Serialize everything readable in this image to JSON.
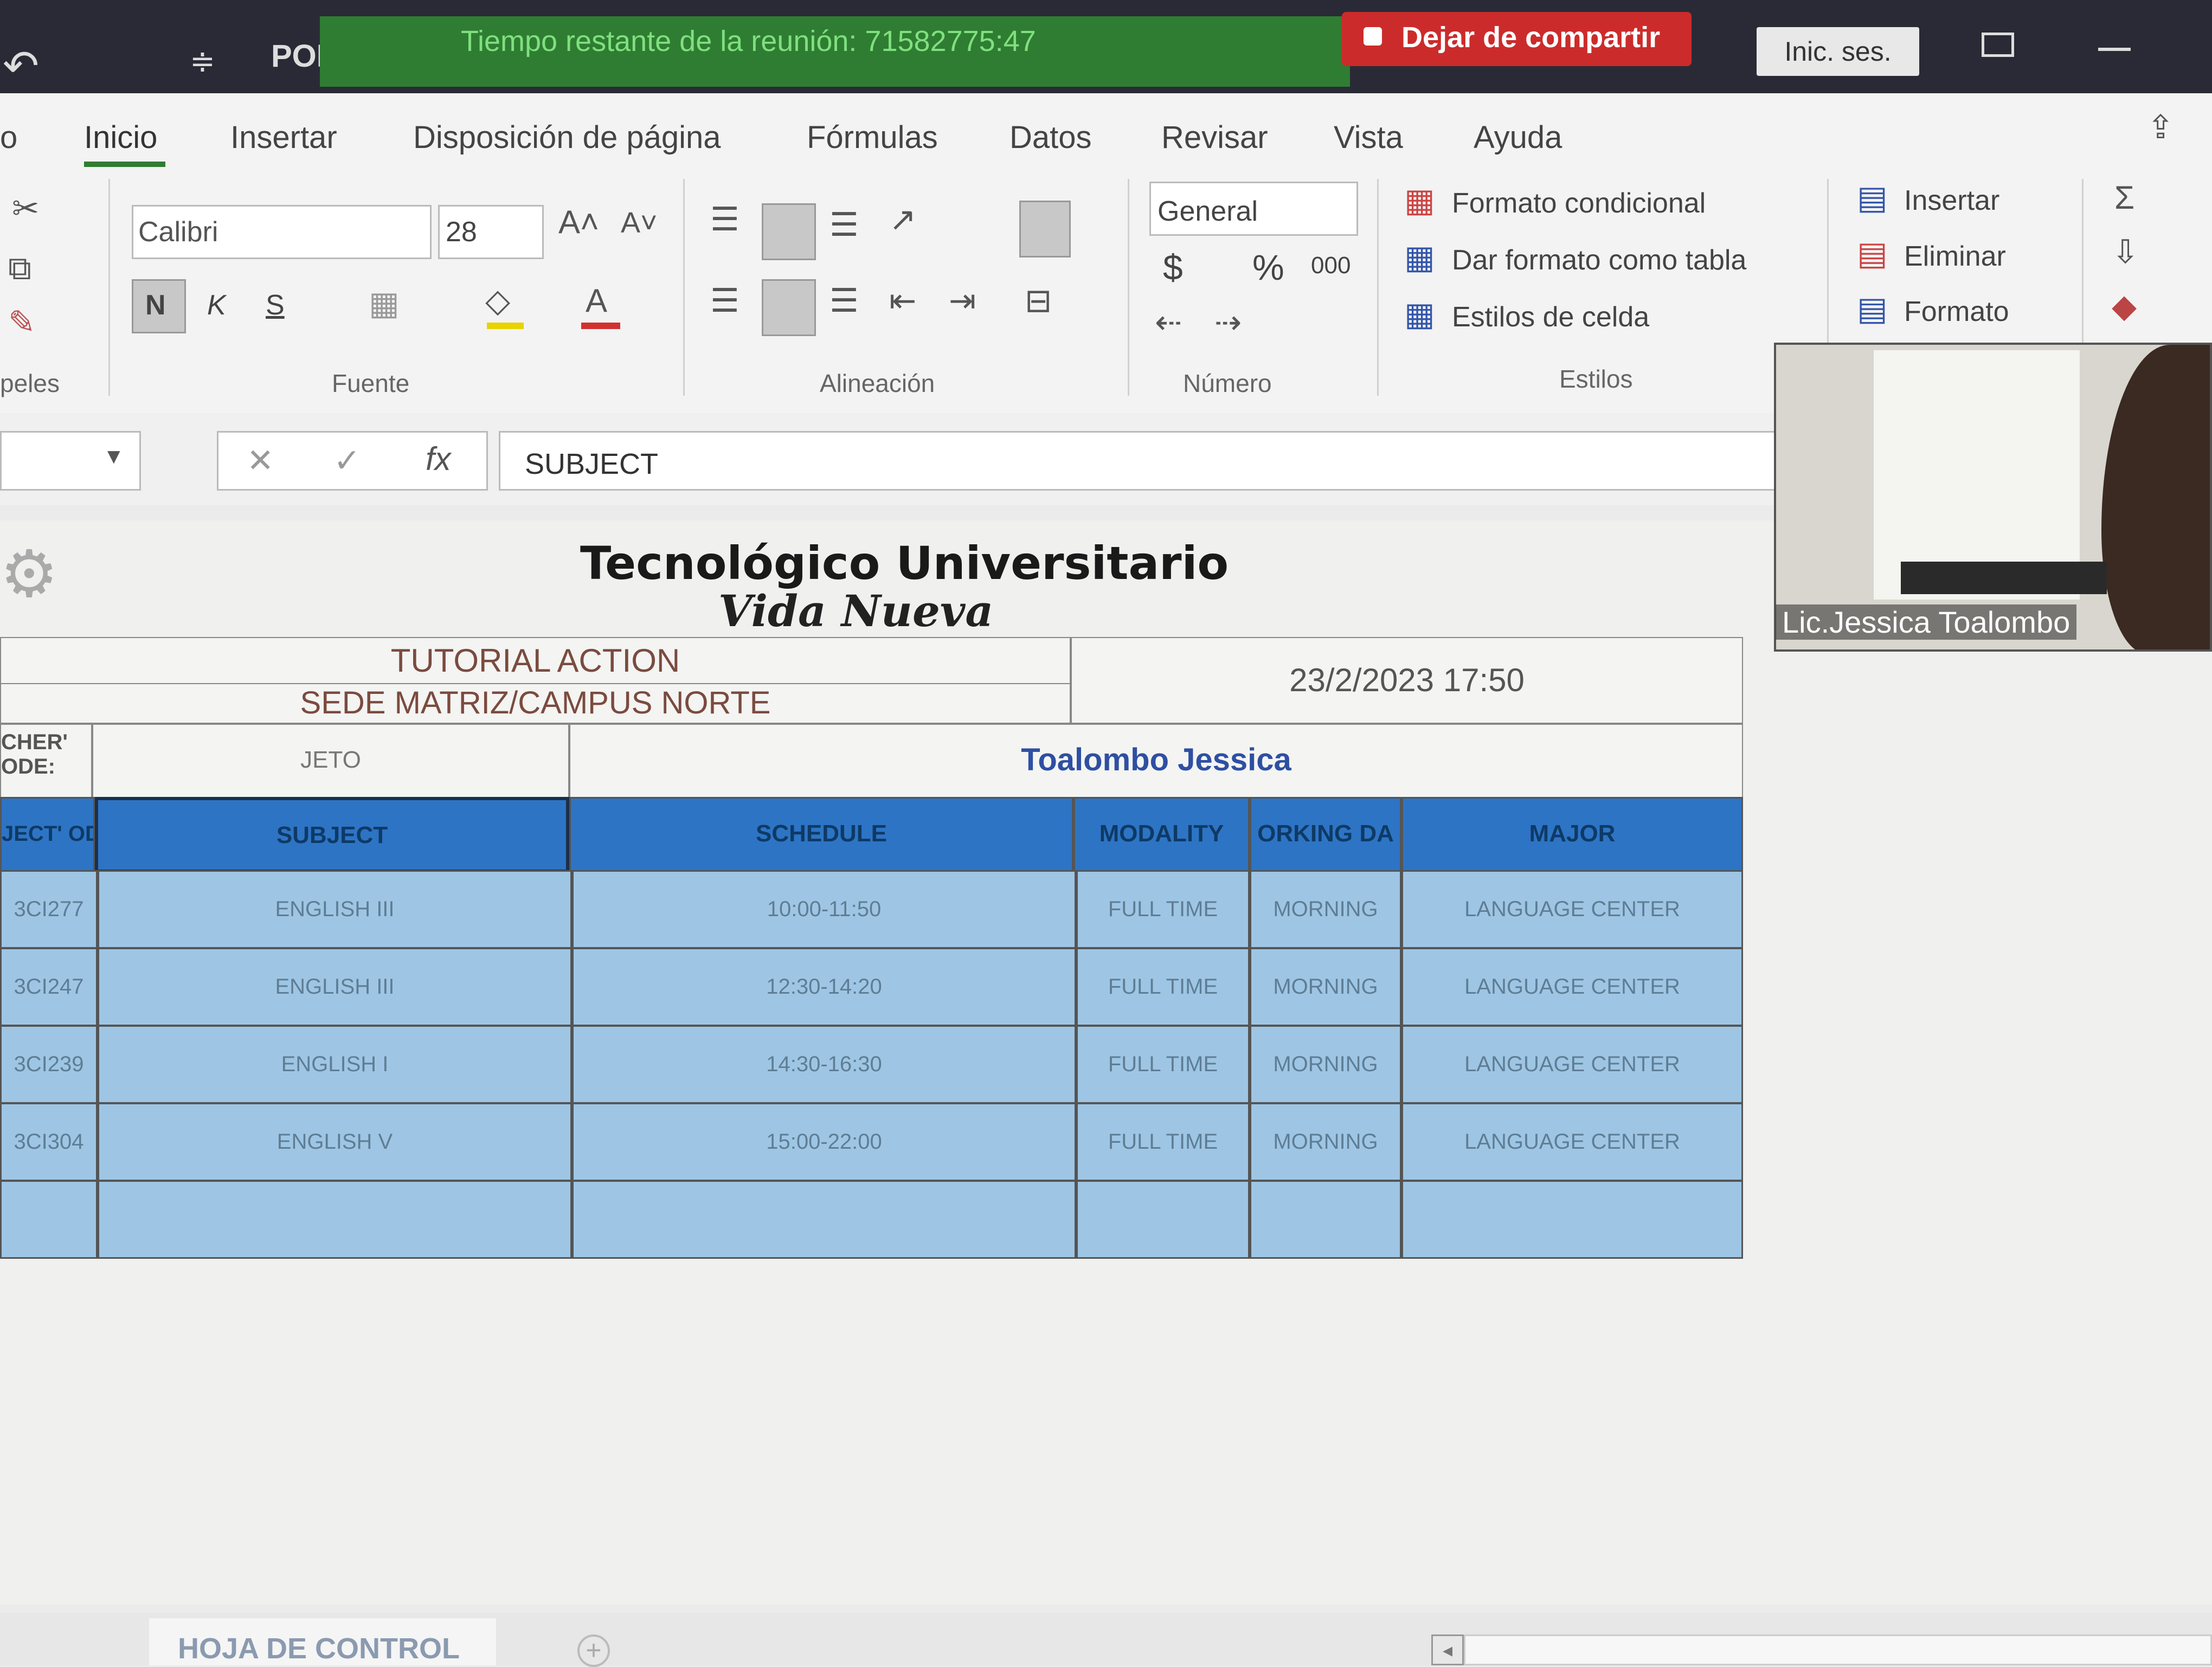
{
  "titlebar": {
    "file_title": "POR",
    "meeting_timer": "Tiempo restante de la reunión: 71582775:47",
    "stop_sharing": "Dejar de compartir",
    "sign_in": "Inic. ses."
  },
  "ribbon": {
    "tabs": [
      "o",
      "Inicio",
      "Insertar",
      "Disposición de página",
      "Fórmulas",
      "Datos",
      "Revisar",
      "Vista",
      "Ayuda"
    ],
    "font_name": "Calibri",
    "font_size": "28",
    "bold": "N",
    "italic": "K",
    "underline": "S",
    "number_format": "General",
    "currency": "$",
    "percent": "%",
    "thousands": "000",
    "conditional_format": "Formato condicional",
    "format_as_table": "Dar formato como tabla",
    "cell_styles": "Estilos de celda",
    "insert": "Insertar",
    "delete": "Eliminar",
    "format": "Formato",
    "groups": {
      "clipboard": "peles",
      "font": "Fuente",
      "alignment": "Alineación",
      "number": "Número",
      "styles": "Estilos"
    }
  },
  "formula_bar": {
    "content": "SUBJECT"
  },
  "sheet": {
    "title_line1": "Tecnológico Universitario",
    "title_line2": "Vida Nueva",
    "subtitle1": "TUTORIAL ACTION",
    "subtitle2": "SEDE MATRIZ/CAMPUS NORTE",
    "datetime": "23/2/2023 17:50",
    "teacher_code_label": "CHER' ODE:",
    "subject_label": "JETO",
    "teacher_name": "Toalombo Jessica",
    "headers": [
      "JECT' ODE:",
      "SUBJECT",
      "SCHEDULE",
      "MODALITY",
      "ORKING DA",
      "MAJOR"
    ],
    "rows": [
      [
        "3CI277",
        "ENGLISH III",
        "10:00-11:50",
        "FULL TIME",
        "MORNING",
        "LANGUAGE CENTER"
      ],
      [
        "3CI247",
        "ENGLISH III",
        "12:30-14:20",
        "FULL TIME",
        "MORNING",
        "LANGUAGE CENTER"
      ],
      [
        "3CI239",
        "ENGLISH I",
        "14:30-16:30",
        "FULL TIME",
        "MORNING",
        "LANGUAGE CENTER"
      ],
      [
        "3CI304",
        "ENGLISH V",
        "15:00-22:00",
        "FULL TIME",
        "MORNING",
        "LANGUAGE CENTER"
      ]
    ]
  },
  "video": {
    "participant_name": "Lic.Jessica Toalombo"
  },
  "sheet_tabs": {
    "active": "HOJA DE CONTROL",
    "add": "+"
  }
}
